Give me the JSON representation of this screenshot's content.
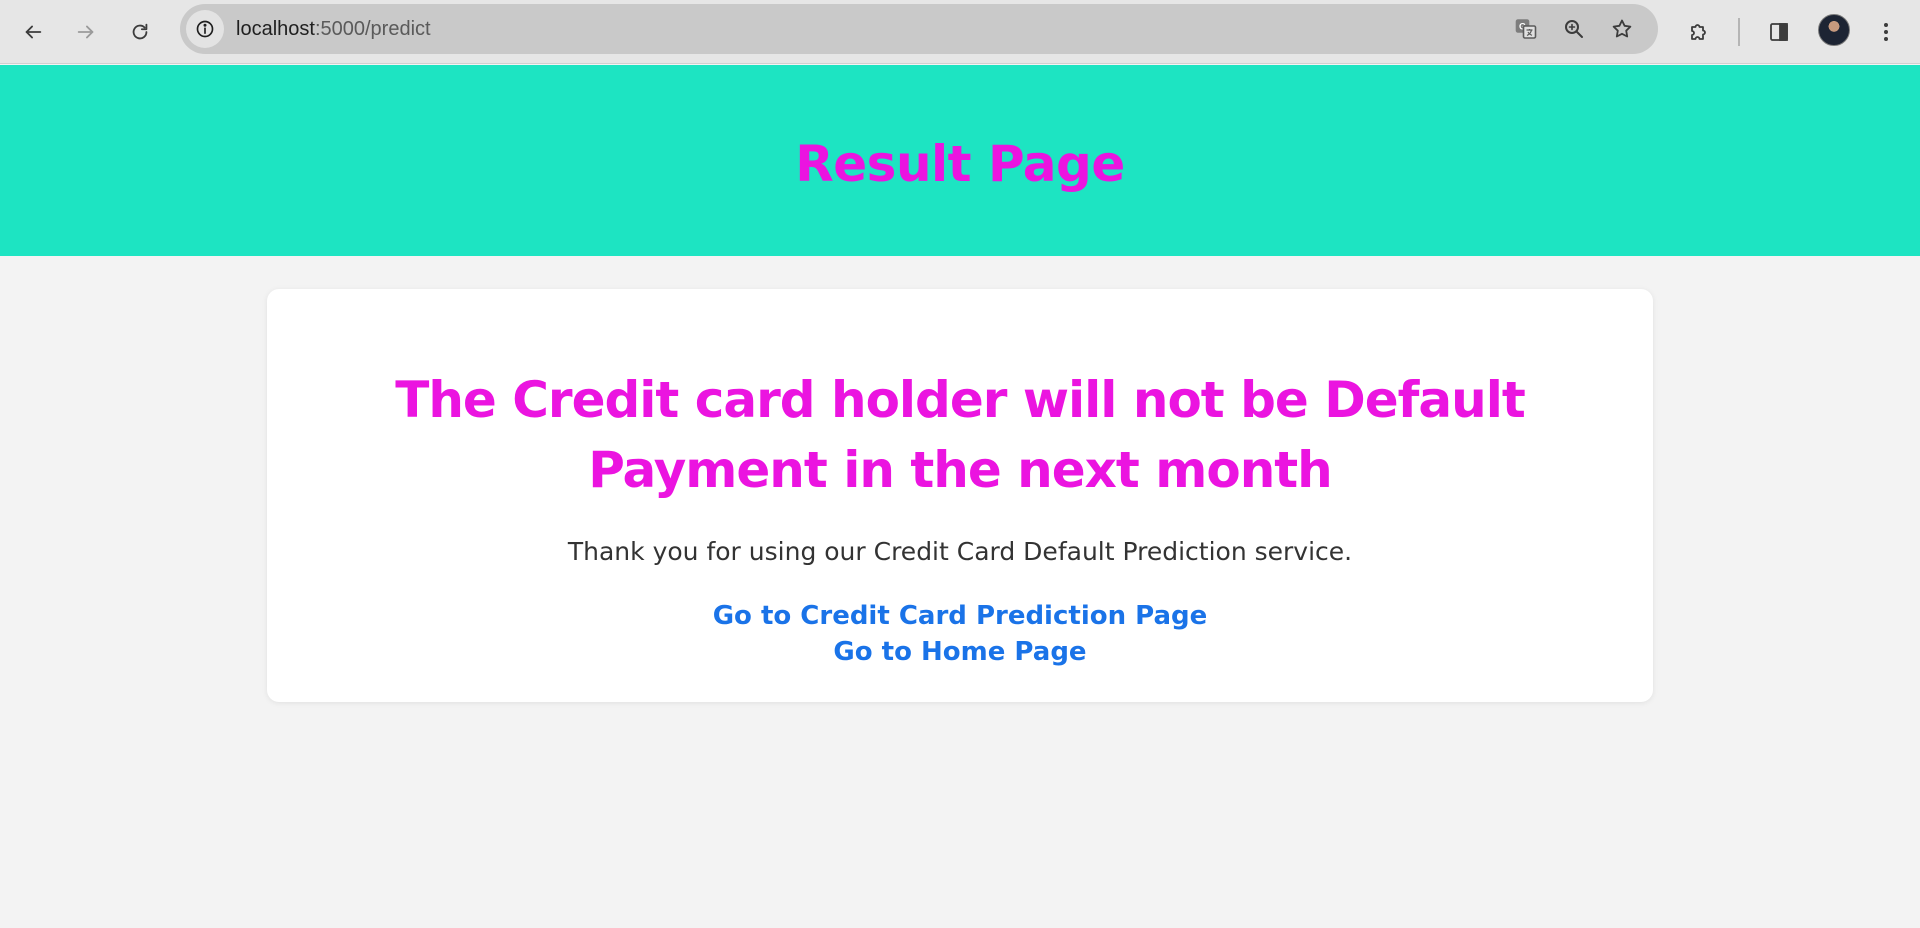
{
  "browser": {
    "url_host": "localhost",
    "url_path": ":5000/predict"
  },
  "header": {
    "title": "Result Page"
  },
  "result": {
    "message": "The Credit card holder will not be Default Payment in the next month",
    "thanks": "Thank you for using our Credit Card Default Prediction service.",
    "links": {
      "prediction_page": "Go to Credit Card Prediction Page",
      "home_page": "Go to Home Page"
    }
  },
  "colors": {
    "header_bg": "#1de4c2",
    "title_color": "#eb14e0",
    "link_color": "#1a73e8",
    "page_bg": "#f3f3f3"
  },
  "icons": {
    "back": "arrow-left-icon",
    "forward": "arrow-right-icon",
    "reload": "reload-icon",
    "site_info": "info-icon",
    "translate": "translate-icon",
    "zoom": "zoom-icon",
    "bookmark": "star-icon",
    "extensions": "puzzle-icon",
    "side_panel": "side-panel-icon",
    "menu": "kebab-menu-icon"
  }
}
